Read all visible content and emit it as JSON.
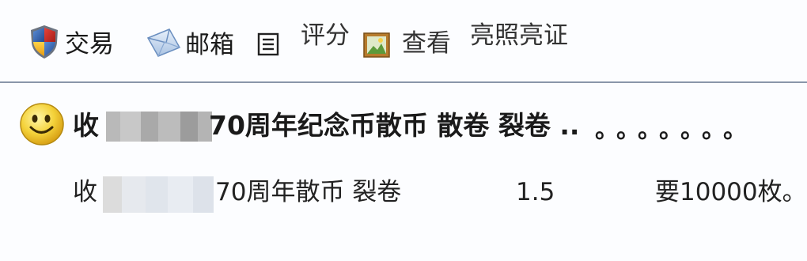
{
  "toolbar": {
    "trade_label": "交易",
    "mailbox_label": "邮箱",
    "rate_label": "评分",
    "view_label": "查看",
    "license_label": "亮照亮证",
    "icons": {
      "trade": "shield-icon",
      "mailbox": "envelope-icon",
      "list": "list-icon",
      "view": "picture-icon"
    }
  },
  "post": {
    "avatar_icon": "smiley-icon",
    "title_prefix": "收",
    "title_rest": "70周年纪念币散币 散卷 裂卷 ..",
    "title_dots": "。。。。。。。",
    "body_prefix": "收",
    "body_rest": "70周年散币 裂卷",
    "price": "1.5",
    "want": "要10000枚。"
  },
  "colors": {
    "background": "#fcfdff",
    "divider": "#8a96aa",
    "text": "#1a1a1a"
  }
}
